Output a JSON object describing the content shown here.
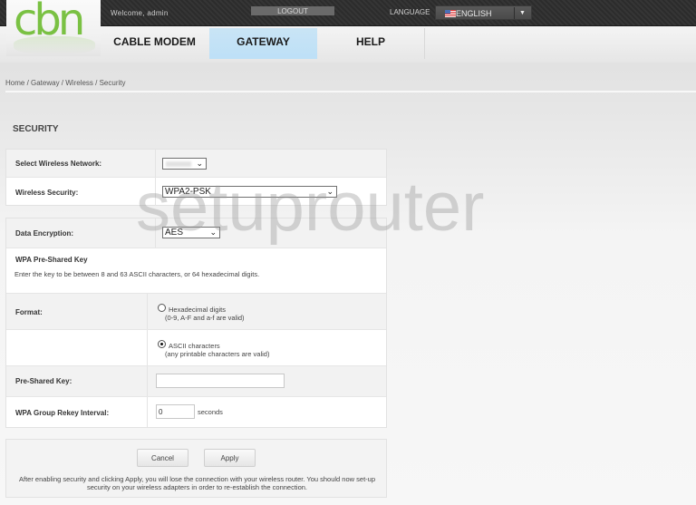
{
  "header": {
    "logo": "cbn",
    "welcome": "Welcome, admin",
    "logout_label": "LOGOUT",
    "language_label": "LANGUAGE",
    "language_value": "ENGLISH",
    "flag_icon": "us-flag-icon"
  },
  "nav": {
    "items": [
      {
        "label": "CABLE MODEM",
        "active": false
      },
      {
        "label": "GATEWAY",
        "active": true
      },
      {
        "label": "HELP",
        "active": false
      }
    ],
    "active_color": "#c4e2f6"
  },
  "breadcrumb": "Home / Gateway / Wireless / Security",
  "page_title": "SECURITY",
  "form": {
    "select_network_label": "Select Wireless Network:",
    "select_network_value": "",
    "wireless_security_label": "Wireless Security:",
    "wireless_security_value": "WPA2-PSK",
    "data_encryption_label": "Data Encryption:",
    "data_encryption_value": "AES",
    "psk_heading": "WPA Pre-Shared Key",
    "psk_hint": "Enter the key to be between 8 and 63 ASCII characters, or 64 hexadecimal digits.",
    "format_label": "Format:",
    "format_options": [
      {
        "label": "Hexadecimal digits",
        "sub": "(0-9, A-F and a-f are valid)",
        "checked": false
      },
      {
        "label": "ASCII characters",
        "sub": "(any printable characters are valid)",
        "checked": true
      }
    ],
    "psk_label": "Pre-Shared Key:",
    "psk_value": "",
    "rekey_label": "WPA Group Rekey Interval:",
    "rekey_value": "0",
    "rekey_unit": "seconds"
  },
  "actions": {
    "cancel_label": "Cancel",
    "apply_label": "Apply",
    "note": "After enabling security and clicking Apply, you will lose the connection with your wireless router. You should now set-up security on your wireless adapters in order to re-establish the connection."
  },
  "watermark": "setuprouter"
}
